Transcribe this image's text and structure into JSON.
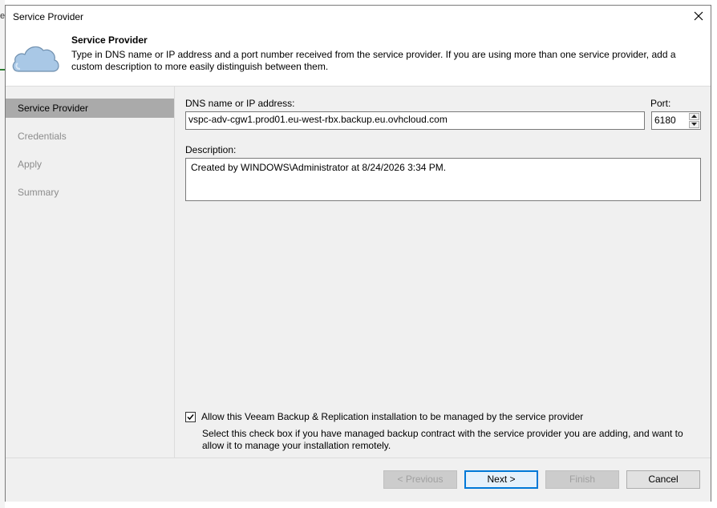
{
  "window": {
    "title": "Service Provider"
  },
  "header": {
    "title": "Service Provider",
    "description": "Type in DNS name or IP address and a port number received from the service provider. If you are using more than one service provider, add a custom description to more easily distinguish between them.",
    "icon": "cloud-icon"
  },
  "steps": [
    {
      "label": "Service Provider",
      "active": true
    },
    {
      "label": "Credentials",
      "active": false
    },
    {
      "label": "Apply",
      "active": false
    },
    {
      "label": "Summary",
      "active": false
    }
  ],
  "form": {
    "dns_label": "DNS name or IP address:",
    "dns_value": "vspc-adv-cgw1.prod01.eu-west-rbx.backup.eu.ovhcloud.com",
    "port_label": "Port:",
    "port_value": "6180",
    "description_label": "Description:",
    "description_value": "Created by WINDOWS\\Administrator at 8/24/2026 3:34 PM.",
    "manage_checkbox_label": "Allow this Veeam Backup & Replication installation to be managed by the service provider",
    "manage_checkbox_checked": true,
    "manage_hint": "Select this check box if you have managed backup contract with the service provider you are adding, and want to allow it to manage your installation remotely."
  },
  "buttons": {
    "previous": "< Previous",
    "next": "Next >",
    "finish": "Finish",
    "cancel": "Cancel"
  },
  "background": {
    "edge_letter": "e"
  },
  "colors": {
    "active_step": "#aaaaaa",
    "pane_bg": "#f0f0f0",
    "default_button_border": "#0078d7"
  }
}
